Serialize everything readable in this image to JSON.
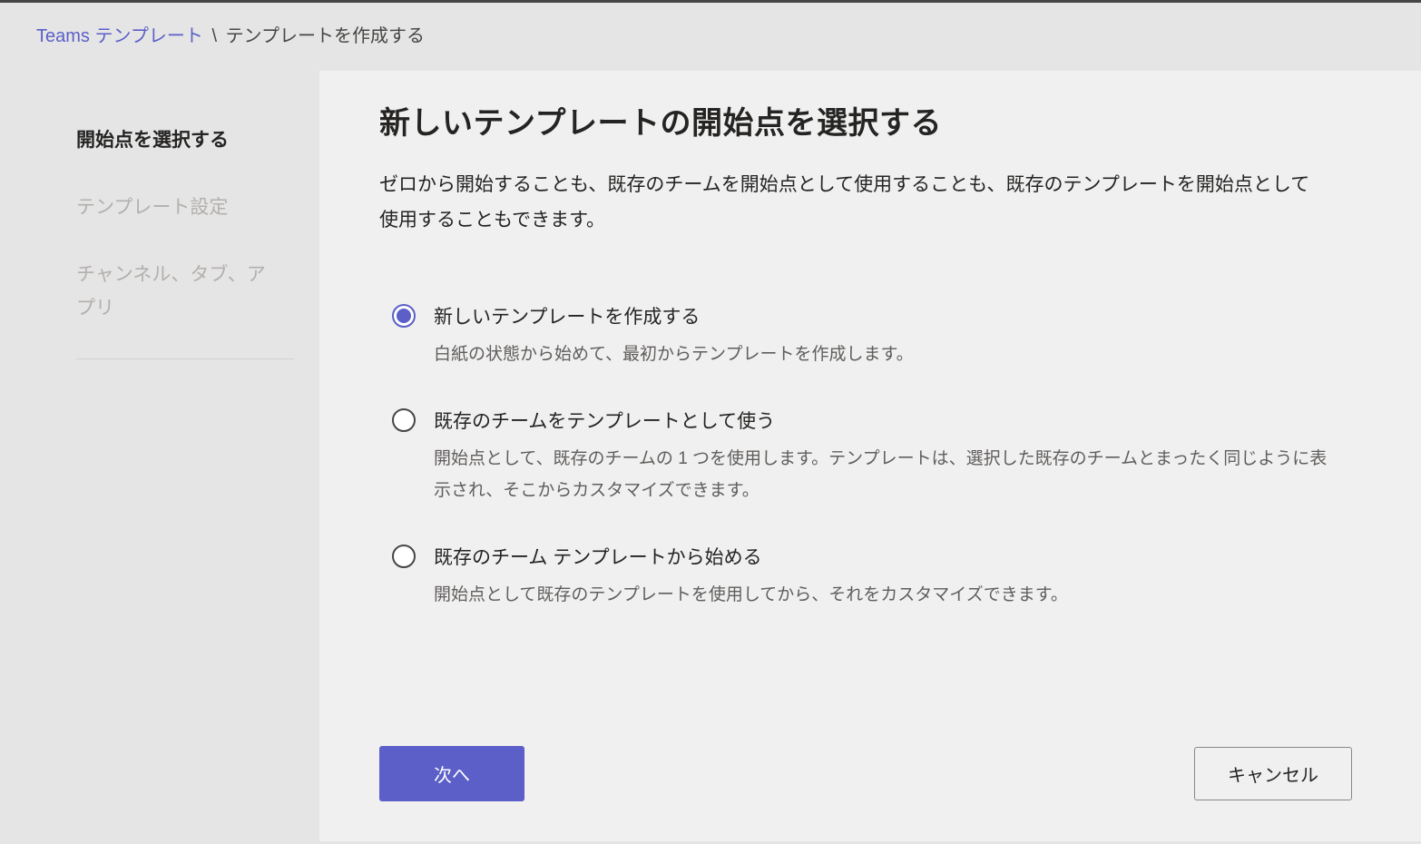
{
  "breadcrumb": {
    "root": "Teams テンプレート",
    "separator": "\\",
    "current": "テンプレートを作成する"
  },
  "sidebar": {
    "steps": [
      {
        "label": "開始点を選択する",
        "active": true
      },
      {
        "label": "テンプレート設定",
        "active": false
      },
      {
        "label": "チャンネル、タブ、アプリ",
        "active": false
      }
    ]
  },
  "main": {
    "title": "新しいテンプレートの開始点を選択する",
    "subtitle": "ゼロから開始することも、既存のチームを開始点として使用することも、既存のテンプレートを開始点として使用することもできます。"
  },
  "options": [
    {
      "title": "新しいテンプレートを作成する",
      "desc": "白紙の状態から始めて、最初からテンプレートを作成します。",
      "selected": true
    },
    {
      "title": "既存のチームをテンプレートとして使う",
      "desc": "開始点として、既存のチームの 1 つを使用します。テンプレートは、選択した既存のチームとまったく同じように表示され、そこからカスタマイズできます。",
      "selected": false
    },
    {
      "title": "既存のチーム テンプレートから始める",
      "desc": "開始点として既存のテンプレートを使用してから、それをカスタマイズできます。",
      "selected": false
    }
  ],
  "footer": {
    "next": "次へ",
    "cancel": "キャンセル"
  },
  "colors": {
    "accent": "#5b5fc7"
  }
}
